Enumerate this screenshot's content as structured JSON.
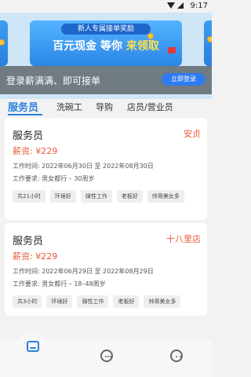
{
  "status_bar": {
    "time": "9:17"
  },
  "banner": {
    "left_partial_text": "取",
    "right_partial_text": "取",
    "pill_text": "新人专属接单奖励",
    "headline_part1": "百元现金",
    "headline_part2": "等你",
    "headline_part3": "来领取"
  },
  "login_prompt": {
    "text": "登录薪满满、即可接单",
    "button": "立即登录"
  },
  "tabs": [
    {
      "label": "服务员",
      "active": true
    },
    {
      "label": "洗碗工",
      "active": false
    },
    {
      "label": "导购",
      "active": false
    },
    {
      "label": "店员/营业员",
      "active": false
    }
  ],
  "jobs": [
    {
      "title": "服务员",
      "location": "安贞",
      "salary": "薪资: ¥229",
      "time": "工作时间:  2022年06月30日 至 2022年08月30日",
      "requirement": "工作要求:  男女都行 – 30周岁",
      "tags": [
        "共21小时",
        "环境好",
        "弹性工作",
        "老板好",
        "帅哥美女多"
      ]
    },
    {
      "title": "服务员",
      "location": "十八里店",
      "salary": "薪资: ¥229",
      "time": "工作时间:  2022年06月29日 至 2022年08月29日",
      "requirement": "工作要求:  男女都行 – 18–48周岁",
      "tags": [
        "共3小时",
        "环境好",
        "弹性工作",
        "老板好",
        "帅哥美女多"
      ]
    }
  ],
  "bottom_nav": [
    {
      "icon": "home-icon",
      "active": true
    },
    {
      "icon": "message-icon",
      "active": false
    },
    {
      "icon": "profile-icon",
      "active": false
    }
  ],
  "colors": {
    "accent": "#2a7fe0",
    "price": "#e85b3a"
  }
}
